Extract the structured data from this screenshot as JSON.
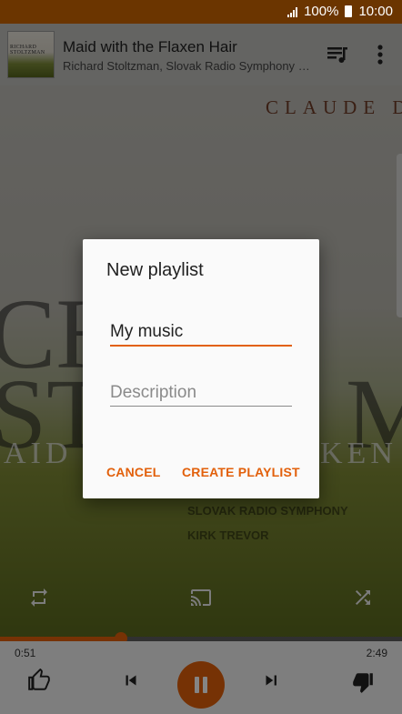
{
  "status_bar": {
    "battery": "100%",
    "time": "10:00",
    "icons": [
      "signal-icon",
      "battery-icon"
    ]
  },
  "now_playing": {
    "title": "Maid with the Flaxen Hair",
    "artist": "Richard Stoltzman, Slovak Radio Symphony Orc..",
    "album_art_texts": {
      "thumb_line1": "RICHARD",
      "thumb_line2": "STOLTZMAN",
      "claude": "CLAUDE D",
      "big_line1": "CH",
      "big_line2": "STO",
      "big_line3": "MA",
      "maid": "AID",
      "xen": "KEN",
      "slovak": "SLOVAK RADIO SYMPHONY",
      "kirk": "KIRK TREVOR"
    }
  },
  "playback": {
    "elapsed": "0:51",
    "total": "2:49",
    "progress_fraction": 0.3
  },
  "dialog": {
    "title": "New playlist",
    "name_value": "My music",
    "description_placeholder": "Description",
    "cancel_label": "CANCEL",
    "create_label": "CREATE PLAYLIST"
  },
  "colors": {
    "accent": "#e2600b",
    "status_bar": "#6b3500",
    "dialog_bg": "#fafafa"
  }
}
